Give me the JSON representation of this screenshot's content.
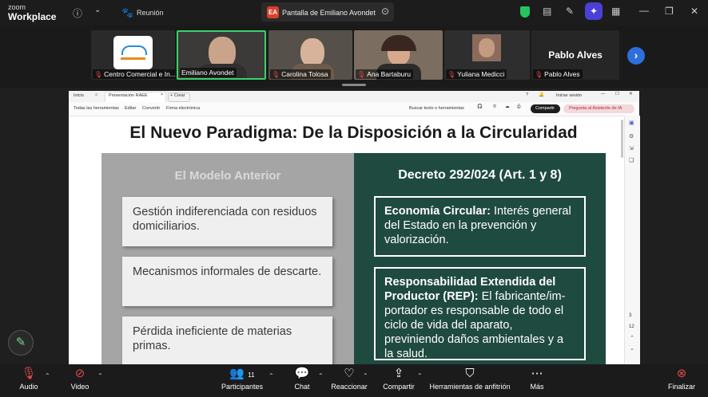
{
  "app": {
    "logo_top": "zoom",
    "logo_bottom": "Workplace"
  },
  "titlebar": {
    "meeting_label": "Reunión",
    "share_initials": "EA",
    "share_title": "Pantalla de Emiliano Avondet"
  },
  "gallery": {
    "participants": [
      {
        "name": "Centro Comercial e In..."
      },
      {
        "name": "Emiliano Avondet"
      },
      {
        "name": "Carolina Tolosa"
      },
      {
        "name": "Ana Bartaburu"
      },
      {
        "name": "Yuliana Medicci"
      },
      {
        "name": "Pablo Alves"
      }
    ],
    "featured_name": "Pablo Alves"
  },
  "browser": {
    "tab_home": "Inicio",
    "tab_active": "Presentación RAEE",
    "tab_new": "+ Crear",
    "signin": "Iniciar sesión",
    "toolbar": {
      "all_tools": "Todas las herramientas",
      "edit": "Editar",
      "convert": "Convertir",
      "sign": "Firma electrónica",
      "search": "Buscar texto o herramientas",
      "share": "Compartir",
      "ai": "Pregunta al Asistente de IA"
    },
    "page_current": "3",
    "page_total": "12"
  },
  "slide": {
    "title": "El Nuevo Paradigma: De la Disposición a la Circularidad",
    "left_heading": "El Modelo Anterior",
    "left_items": [
      "Gestión indiferenciada con residuos domiciliarios.",
      "Mecanismos informales de descarte.",
      "Pérdida ineficiente de materias primas."
    ],
    "right_heading": "Decreto 292/024 (Art. 1 y 8)",
    "right_items": [
      {
        "term": "Economía Circular:",
        "text": " Interés general del Estado en la prevención y valorización."
      },
      {
        "term": "Responsabilidad Extendida del Productor (REP):",
        "text": " El fabricante/im-portador es responsable de todo el ciclo de vida del aparato, previniendo daños ambientales y a la salud."
      }
    ]
  },
  "bottombar": {
    "audio": "Audio",
    "video": "Video",
    "participants": "Participantes",
    "participants_count": "11",
    "chat": "Chat",
    "react": "Reaccionar",
    "share": "Compartir",
    "host_tools": "Herramientas de anfitrión",
    "more": "Más",
    "end": "Finalizar"
  }
}
